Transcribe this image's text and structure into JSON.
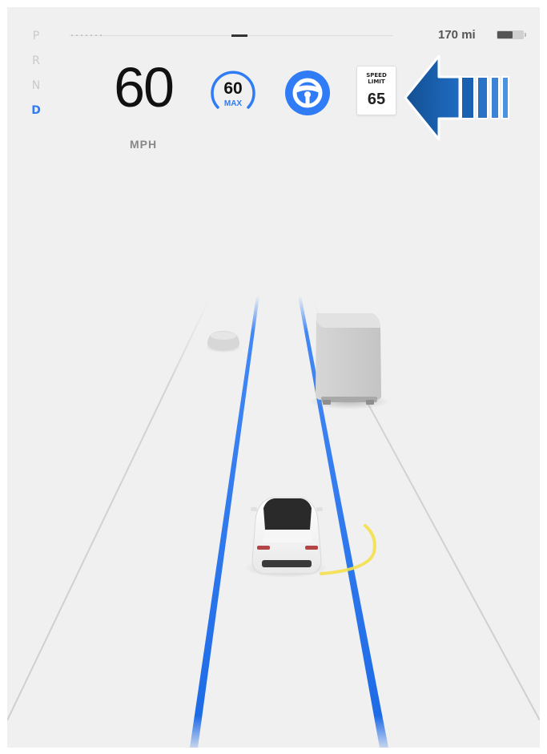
{
  "gear_selector": {
    "gears": [
      "P",
      "R",
      "N",
      "D"
    ],
    "active": "D"
  },
  "status_bar": {
    "range": "170 mi",
    "battery_level": 0.6
  },
  "speedometer": {
    "speed": "60",
    "unit": "MPH"
  },
  "cruise_control": {
    "set_speed": "60",
    "label": "MAX"
  },
  "autosteer": {
    "icon": "steering-wheel-icon",
    "state": "active"
  },
  "speed_limit_sign": {
    "label_line1": "SPEED",
    "label_line2": "LIMIT",
    "value": "65"
  },
  "lane_change": {
    "icon": "arrow-left-icon",
    "direction": "left"
  },
  "road_view": {
    "vehicles": [
      {
        "name": "ego-car",
        "type": "sedan"
      },
      {
        "name": "truck",
        "type": "box-truck"
      },
      {
        "name": "cone",
        "type": "obstacle"
      }
    ],
    "lane_highlight_color": "#1e6be6",
    "blind_spot_color": "#f4e04d"
  },
  "colors": {
    "accent": "#2f7cf6",
    "background": "#f0f0f0",
    "arrow": "#1b5fa8"
  }
}
